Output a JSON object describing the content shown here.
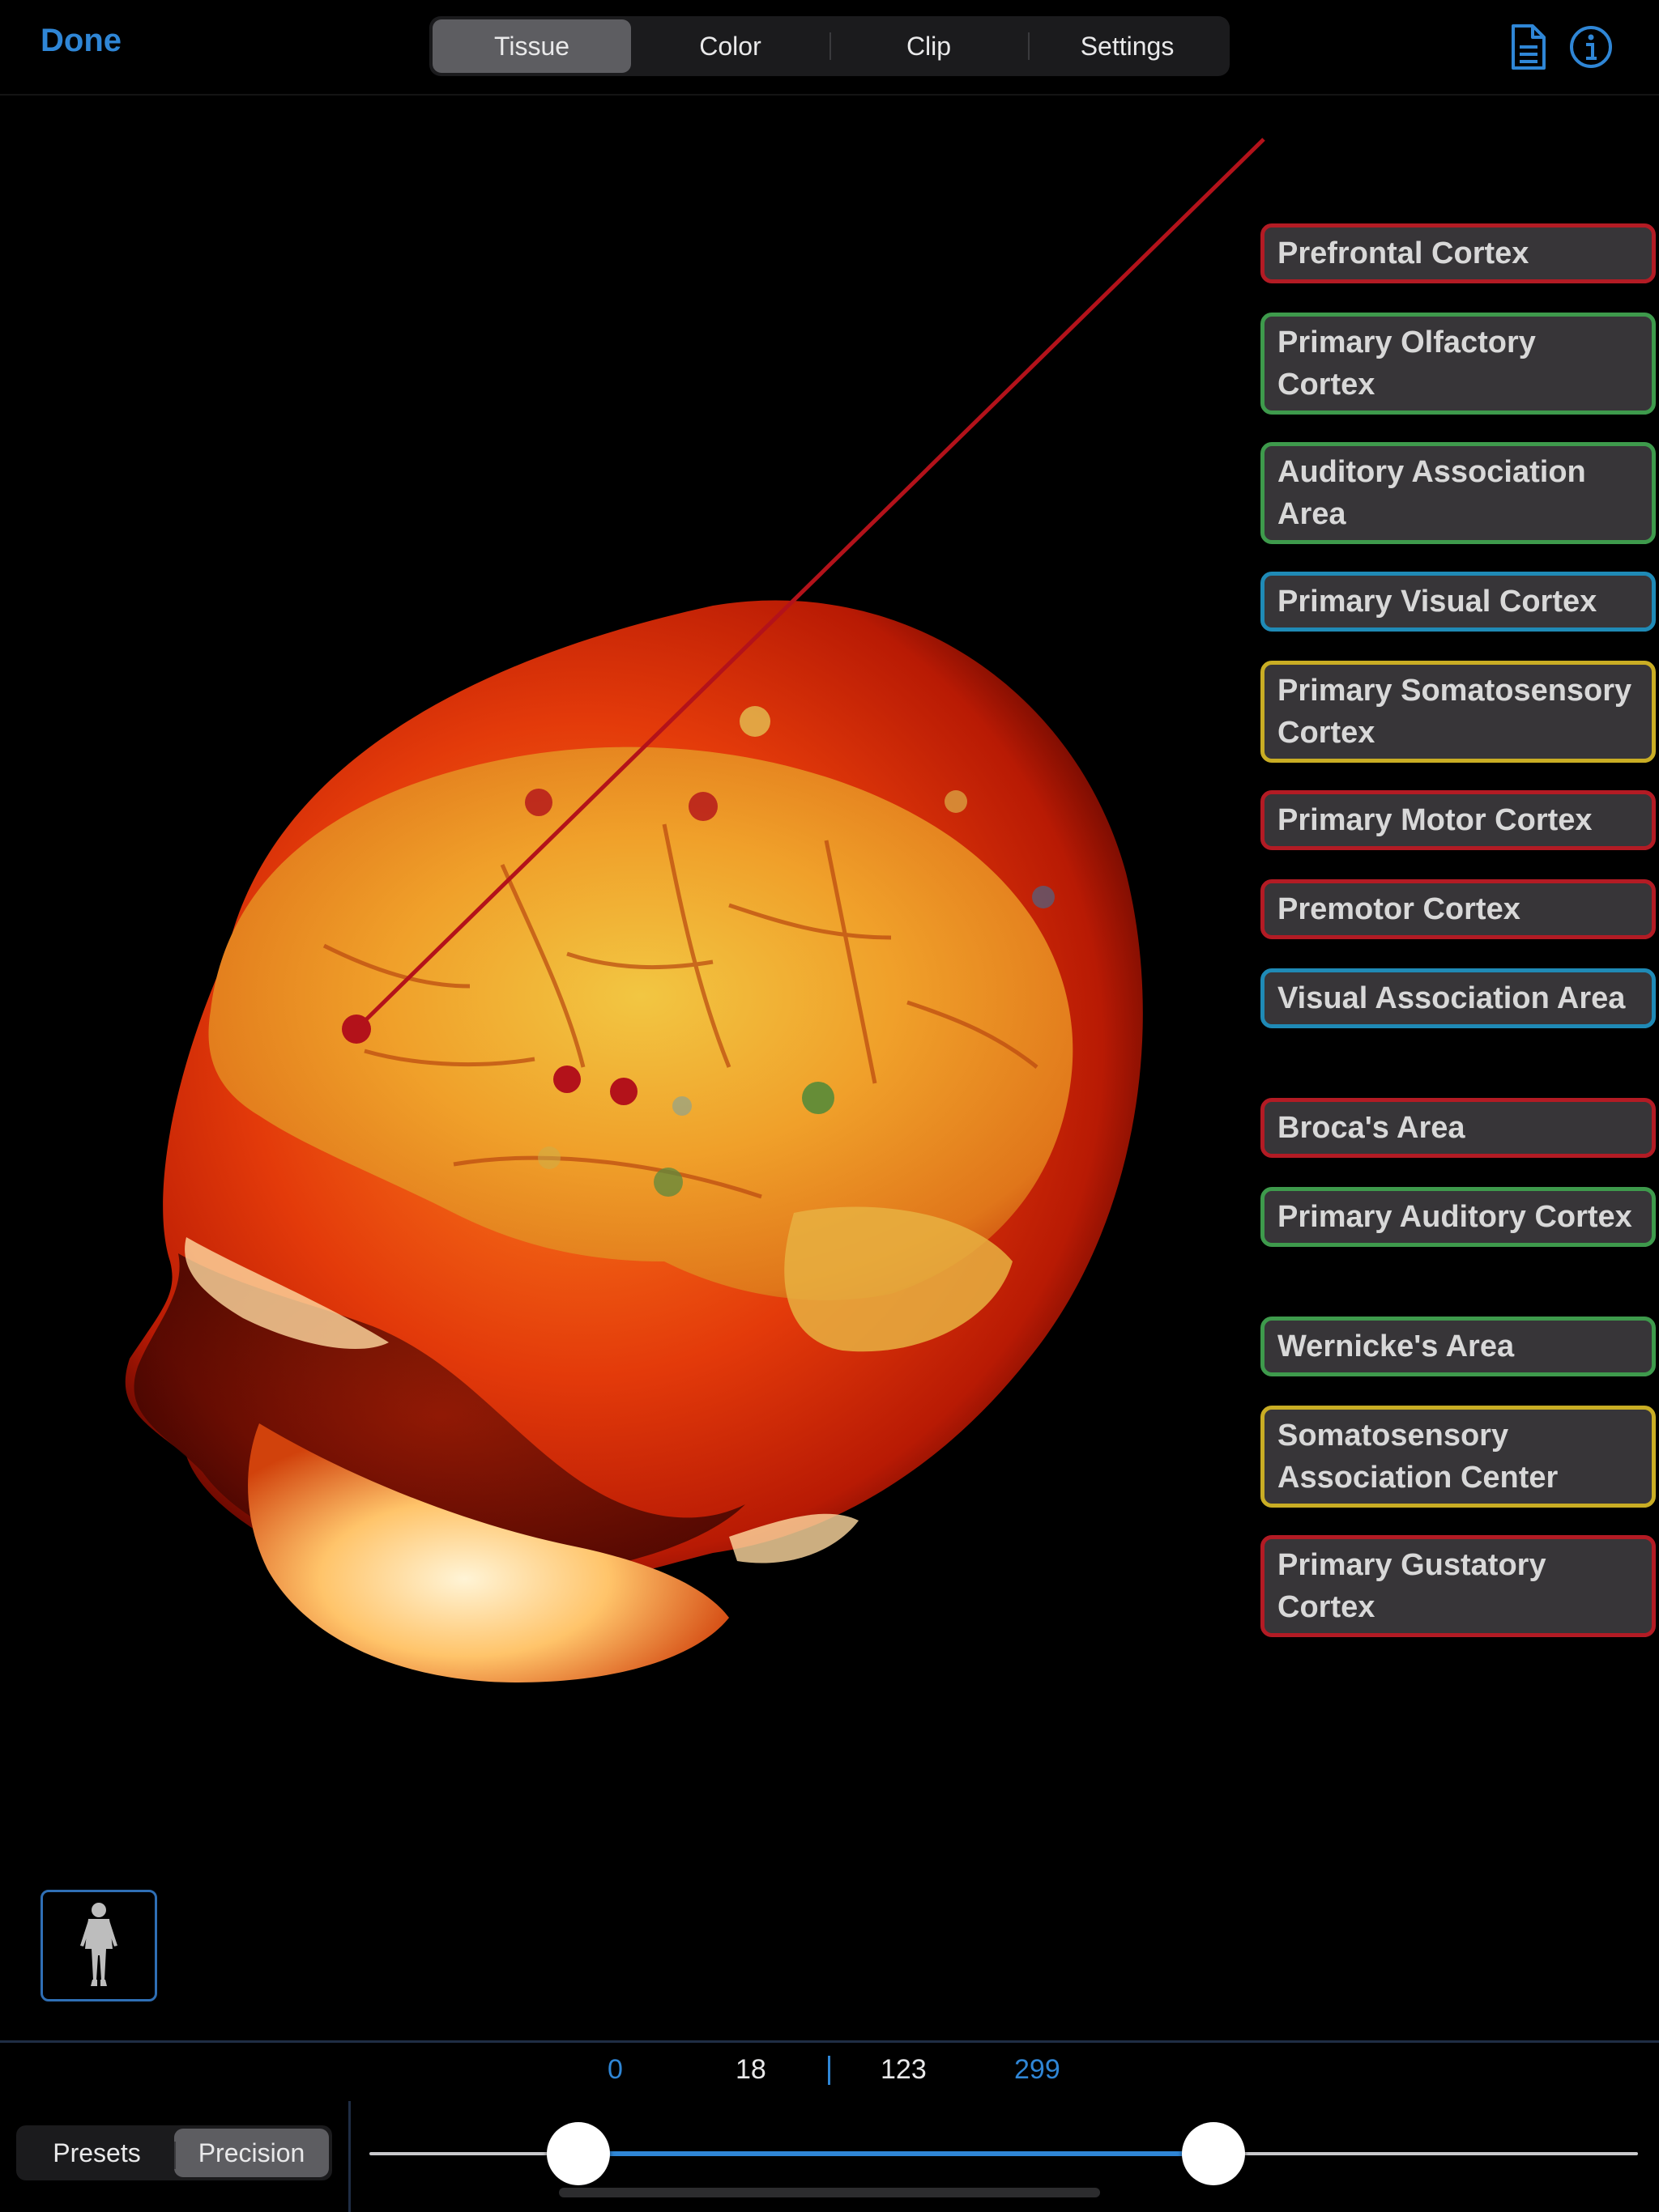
{
  "toolbar": {
    "done_label": "Done",
    "tabs": [
      {
        "label": "Tissue",
        "active": true
      },
      {
        "label": "Color",
        "active": false
      },
      {
        "label": "Clip",
        "active": false
      },
      {
        "label": "Settings",
        "active": false
      }
    ],
    "right_icons": [
      "document-icon",
      "info-icon"
    ]
  },
  "labels": [
    {
      "text": "Prefrontal Cortex",
      "color": "#b31b24"
    },
    {
      "text": "Primary Olfactory Cortex",
      "color": "#3e9a4c"
    },
    {
      "text": "Auditory Association Area",
      "color": "#3e9a4c"
    },
    {
      "text": "Primary Visual Cortex",
      "color": "#1f8ab6"
    },
    {
      "text": "Primary Somatosensory Cortex",
      "color": "#c9ad24"
    },
    {
      "text": "Primary Motor Cortex",
      "color": "#b31b24"
    },
    {
      "text": "Premotor Cortex",
      "color": "#b31b24"
    },
    {
      "text": "Visual Association Area",
      "color": "#1f8ab6"
    },
    {
      "text": "Broca's Area",
      "color": "#b31b24"
    },
    {
      "text": "Primary Auditory Cortex",
      "color": "#3e9a4c"
    },
    {
      "text": "Wernicke's Area",
      "color": "#3e9a4c"
    },
    {
      "text": "Somatosensory Association Center",
      "color": "#c9ad24"
    },
    {
      "text": "Primary Gustatory Cortex",
      "color": "#b31b24"
    }
  ],
  "range": {
    "min": "0",
    "low": "18",
    "high": "123",
    "max": "299"
  },
  "bottom": {
    "mode_tabs": [
      {
        "label": "Presets",
        "active": false
      },
      {
        "label": "Precision",
        "active": true
      }
    ]
  },
  "colors": {
    "accent": "#2f86d6",
    "red_label": "#b31b24",
    "green_label": "#3e9a4c",
    "blue_label": "#1f8ab6",
    "yellow_label": "#c9ad24"
  }
}
